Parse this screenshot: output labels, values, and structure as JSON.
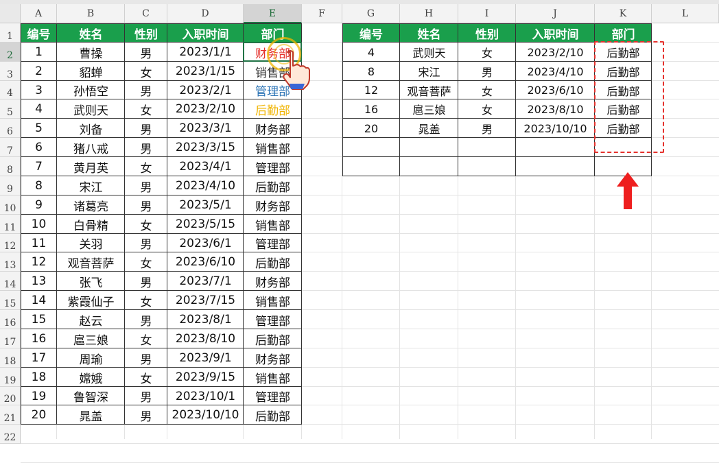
{
  "columns": [
    "A",
    "B",
    "C",
    "D",
    "E",
    "F",
    "G",
    "H",
    "I",
    "J",
    "K",
    "L"
  ],
  "rows": [
    "1",
    "2",
    "3",
    "4",
    "5",
    "6",
    "7",
    "8",
    "9",
    "10",
    "11",
    "12",
    "13",
    "14",
    "15",
    "16",
    "17",
    "18",
    "19",
    "20",
    "21",
    "22"
  ],
  "left_table": {
    "headers": [
      "编号",
      "姓名",
      "性别",
      "入职时间",
      "部门"
    ],
    "rows": [
      [
        "1",
        "曹操",
        "男",
        "2023/1/1",
        "财务部"
      ],
      [
        "2",
        "貂蝉",
        "女",
        "2023/1/15",
        "销售部"
      ],
      [
        "3",
        "孙悟空",
        "男",
        "2023/2/1",
        "管理部"
      ],
      [
        "4",
        "武则天",
        "女",
        "2023/2/10",
        "后勤部"
      ],
      [
        "5",
        "刘备",
        "男",
        "2023/3/1",
        "财务部"
      ],
      [
        "6",
        "猪八戒",
        "男",
        "2023/3/15",
        "销售部"
      ],
      [
        "7",
        "黄月英",
        "女",
        "2023/4/1",
        "管理部"
      ],
      [
        "8",
        "宋江",
        "男",
        "2023/4/10",
        "后勤部"
      ],
      [
        "9",
        "诸葛亮",
        "男",
        "2023/5/1",
        "财务部"
      ],
      [
        "10",
        "白骨精",
        "女",
        "2023/5/15",
        "销售部"
      ],
      [
        "11",
        "关羽",
        "男",
        "2023/6/1",
        "管理部"
      ],
      [
        "12",
        "观音菩萨",
        "女",
        "2023/6/10",
        "后勤部"
      ],
      [
        "13",
        "张飞",
        "男",
        "2023/7/1",
        "财务部"
      ],
      [
        "14",
        "紫霞仙子",
        "女",
        "2023/7/15",
        "销售部"
      ],
      [
        "15",
        "赵云",
        "男",
        "2023/8/1",
        "管理部"
      ],
      [
        "16",
        "扈三娘",
        "女",
        "2023/8/10",
        "后勤部"
      ],
      [
        "17",
        "周瑜",
        "男",
        "2023/9/1",
        "财务部"
      ],
      [
        "18",
        "嫦娥",
        "女",
        "2023/9/15",
        "销售部"
      ],
      [
        "19",
        "鲁智深",
        "男",
        "2023/10/1",
        "管理部"
      ],
      [
        "20",
        "晁盖",
        "男",
        "2023/10/10",
        "后勤部"
      ]
    ]
  },
  "right_table": {
    "headers": [
      "编号",
      "姓名",
      "性别",
      "入职时间",
      "部门"
    ],
    "rows": [
      [
        "4",
        "武则天",
        "女",
        "2023/2/10",
        "后勤部"
      ],
      [
        "8",
        "宋江",
        "男",
        "2023/4/10",
        "后勤部"
      ],
      [
        "12",
        "观音菩萨",
        "女",
        "2023/6/10",
        "后勤部"
      ],
      [
        "16",
        "扈三娘",
        "女",
        "2023/8/10",
        "后勤部"
      ],
      [
        "20",
        "晁盖",
        "男",
        "2023/10/10",
        "后勤部"
      ],
      [
        "",
        "",
        "",
        "",
        ""
      ],
      [
        "",
        "",
        "",
        "",
        ""
      ]
    ]
  },
  "colors": {
    "header_green": "#1a9f4c",
    "selection": "#217346",
    "annotation_red": "#e5322d",
    "dept_colors": {
      "E2": "#e5322d",
      "E3": "#333333",
      "E4": "#2e75b6",
      "E5": "#f0b400"
    }
  },
  "cursor": {
    "icon": "hand-pointer-icon"
  },
  "annotation": {
    "icon": "red-up-arrow-icon"
  }
}
